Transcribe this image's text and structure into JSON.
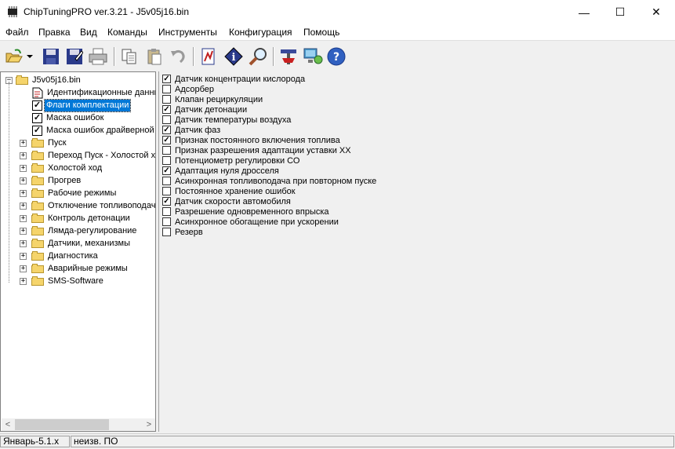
{
  "window": {
    "title": "ChipTuningPRO ver.3.21 - J5v05j16.bin",
    "minimize": "—",
    "maximize": "☐",
    "close": "✕"
  },
  "menu": [
    "Файл",
    "Правка",
    "Вид",
    "Команды",
    "Инструменты",
    "Конфигурация",
    "Помощь"
  ],
  "toolbar": {
    "icons": [
      "open-folder-icon",
      "dropdown-arrow-icon",
      "save-icon",
      "save-as-icon",
      "print-icon",
      "copy-icon",
      "paste-icon",
      "undo-icon",
      "chart-icon",
      "info-icon",
      "search-icon",
      "tools-icon",
      "connect-icon",
      "help-icon"
    ]
  },
  "tree": {
    "root": "J5v05j16.bin",
    "items": [
      {
        "label": "Идентификационные данные",
        "type": "doc"
      },
      {
        "label": "Флаги комплектации",
        "type": "check",
        "selected": true
      },
      {
        "label": "Маска ошибок",
        "type": "check"
      },
      {
        "label": "Маска ошибок драйверной",
        "type": "check"
      },
      {
        "label": "Пуск",
        "type": "folder"
      },
      {
        "label": "Переход Пуск - Холостой ход",
        "type": "folder"
      },
      {
        "label": "Холостой ход",
        "type": "folder"
      },
      {
        "label": "Прогрев",
        "type": "folder"
      },
      {
        "label": "Рабочие режимы",
        "type": "folder"
      },
      {
        "label": "Отключение топливоподачи",
        "type": "folder"
      },
      {
        "label": "Контроль детонации",
        "type": "folder"
      },
      {
        "label": "Лямда-регулирование",
        "type": "folder"
      },
      {
        "label": "Датчики, механизмы",
        "type": "folder"
      },
      {
        "label": "Диагностика",
        "type": "folder"
      },
      {
        "label": "Аварийные режимы",
        "type": "folder"
      },
      {
        "label": "SMS-Software",
        "type": "folder"
      }
    ]
  },
  "flags": [
    {
      "label": "Датчик концентрации кислорода",
      "checked": true
    },
    {
      "label": "Адсорбер",
      "checked": false
    },
    {
      "label": "Клапан рециркуляции",
      "checked": false
    },
    {
      "label": "Датчик детонации",
      "checked": true
    },
    {
      "label": "Датчик температуры воздуха",
      "checked": false
    },
    {
      "label": "Датчик фаз",
      "checked": true
    },
    {
      "label": "Признак постоянного включения топлива",
      "checked": true
    },
    {
      "label": "Признак разрешения адаптации уставки ХХ",
      "checked": false
    },
    {
      "label": "Потенциометр регулировки СО",
      "checked": false
    },
    {
      "label": "Адаптация нуля дросселя",
      "checked": true
    },
    {
      "label": "Асинхронная топливоподача при повторном пуске",
      "checked": false
    },
    {
      "label": "Постоянное хранение ошибок",
      "checked": false
    },
    {
      "label": "Датчик скорости автомобиля",
      "checked": true
    },
    {
      "label": "Разрешение одновременного впрыска",
      "checked": false
    },
    {
      "label": "Асинхронное обогащение при ускорении",
      "checked": false
    },
    {
      "label": "Резерв",
      "checked": false
    }
  ],
  "status": [
    "Январь-5.1.x",
    "неизв. ПО"
  ],
  "scroll": {
    "left": "<",
    "right": ">"
  }
}
